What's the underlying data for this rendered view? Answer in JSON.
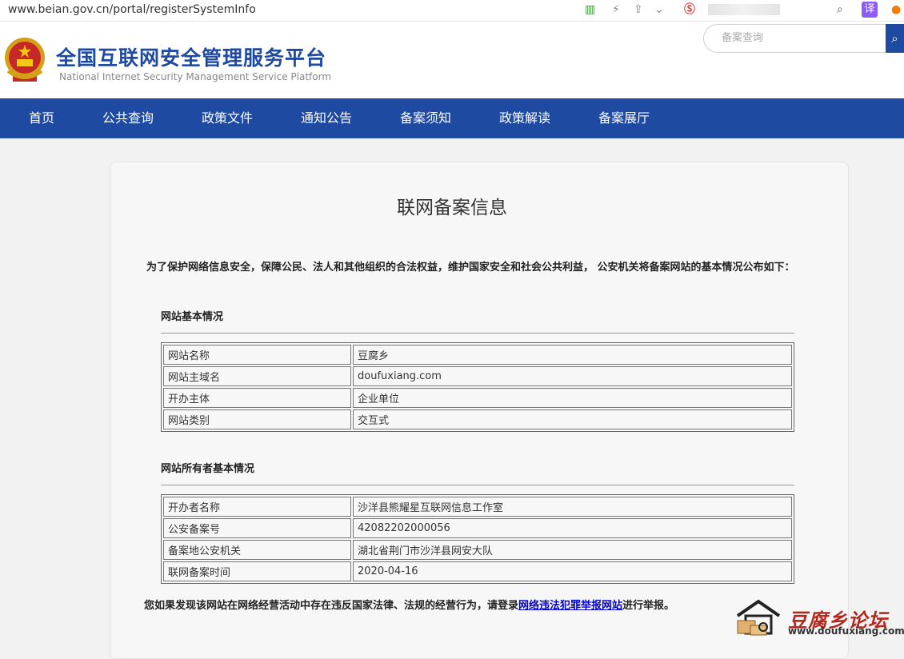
{
  "browser": {
    "url": "www.beian.gov.cn/portal/registerSystemInfo",
    "translate_label": "译"
  },
  "header": {
    "title": "全国互联网安全管理服务平台",
    "subtitle": "National Internet Security Management Service Platform",
    "search_placeholder": "备案查询"
  },
  "nav": {
    "items": [
      "首页",
      "公共查询",
      "政策文件",
      "通知公告",
      "备案须知",
      "政策解读",
      "备案展厅"
    ]
  },
  "card": {
    "title": "联网备案信息",
    "intro": "为了保护网络信息安全，保障公民、法人和其他组织的合法权益，维护国家安全和社会公共利益， 公安机关将备案网站的基本情况公布如下：",
    "section1": {
      "title": "网站基本情况",
      "rows": [
        {
          "label": "网站名称",
          "value": "豆腐乡"
        },
        {
          "label": "网站主域名",
          "value": "doufuxiang.com"
        },
        {
          "label": "开办主体",
          "value": "企业单位"
        },
        {
          "label": "网站类别",
          "value": "交互式"
        }
      ]
    },
    "section2": {
      "title": "网站所有者基本情况",
      "rows": [
        {
          "label": "开办者名称",
          "value": "沙洋县熊耀星互联网信息工作室"
        },
        {
          "label": "公安备案号",
          "value": "42082202000056"
        },
        {
          "label": "备案地公安机关",
          "value": "湖北省荆门市沙洋县网安大队"
        },
        {
          "label": "联网备案时间",
          "value": "2020-04-16"
        }
      ]
    },
    "report": {
      "prefix": "您如果发现该网站在网络经营活动中存在违反国家法律、法规的经营行为，请登录",
      "link": "网络违法犯罪举报网站",
      "suffix": "进行举报。"
    }
  },
  "watermark": {
    "title": "豆腐乡论坛",
    "url": "www.doufuxiang.com"
  },
  "colors": {
    "brand": "#1e4aa1",
    "link": "#0000cc",
    "watermark": "#b22a1f"
  }
}
